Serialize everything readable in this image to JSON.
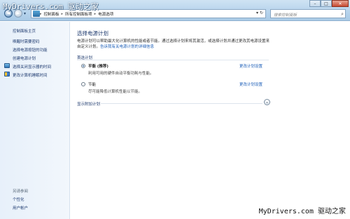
{
  "watermark": {
    "top": "MyDrivers.com 驱动之家",
    "bottom": "MyDrivers.com 驱动之家"
  },
  "nav": {
    "back": "◄",
    "forward": "►",
    "dropdown": "▾"
  },
  "address": {
    "crumbs": [
      "控制面板",
      "所有控制面板项",
      "电源选项"
    ],
    "arrows": "▾ ↻"
  },
  "search": {
    "placeholder": "搜索控制面板",
    "icon": "search-icon"
  },
  "window_controls": {
    "minimize": "–",
    "maximize": "□",
    "close": "✕"
  },
  "sidebar": {
    "home": "控制面板主页",
    "links": [
      "唤醒时需要密码",
      "选择电源按钮的功能",
      "创建电源计划",
      "选择关闭显示器的时间",
      "更改计算机睡眠时间"
    ],
    "see_also_heading": "另请参阅",
    "see_also": [
      "个性化",
      "用户帐户"
    ]
  },
  "main": {
    "title": "选择电源计划",
    "description": "电源计划可以帮助最大化计算机的性能或者节能。通过选择计划来将其激活，或选择计划并通过更改其电源设置来自定义计划。",
    "description_link": "告诉我有关电源计划的详细信息",
    "section_label": "首选计划",
    "plans": [
      {
        "name": "平衡 (推荐)",
        "desc": "利用可用的硬件自动平衡功耗与性能。",
        "link": "更改计划设置",
        "selected": true
      },
      {
        "name": "节能",
        "desc": "尽可能降低计算机性能以节能。",
        "link": "更改计划设置",
        "selected": false
      }
    ],
    "expander_label": "显示附加计划",
    "expander_icon": "⌄"
  }
}
